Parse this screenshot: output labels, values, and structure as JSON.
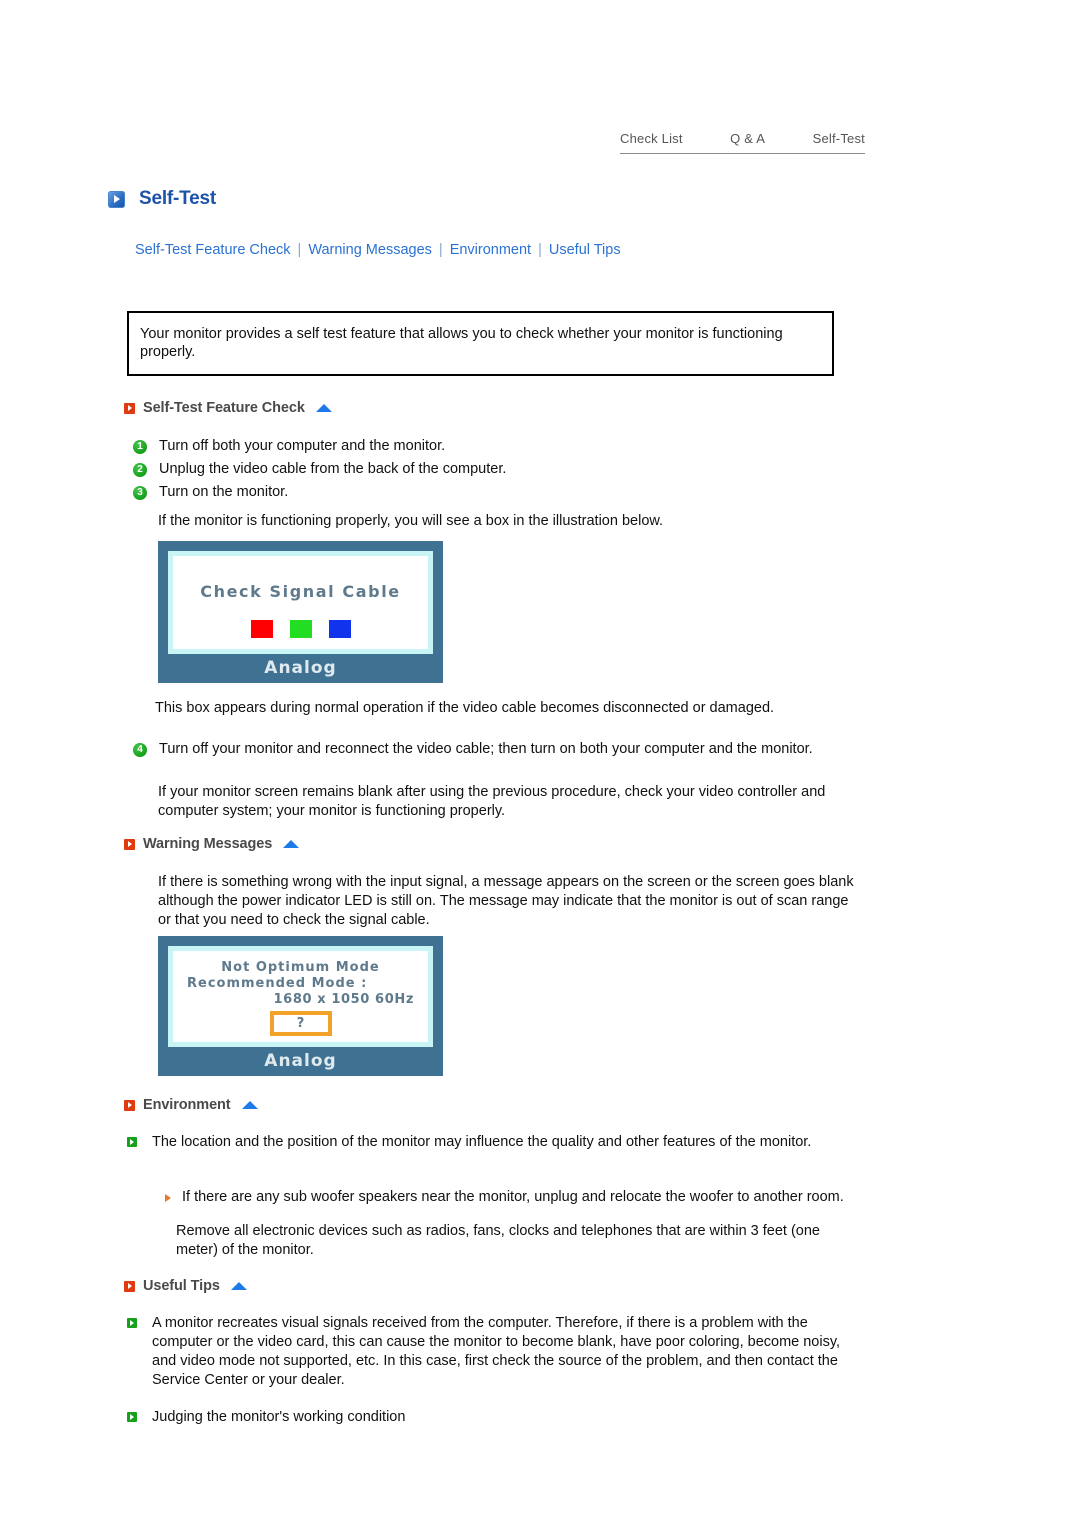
{
  "topnav": {
    "items": [
      {
        "label": "Check List"
      },
      {
        "label": "Q & A"
      },
      {
        "label": "Self-Test"
      }
    ]
  },
  "header": {
    "title": "Self-Test",
    "icon": "blue-play-square-icon"
  },
  "anchor_links": {
    "items": [
      {
        "label": "Self-Test Feature Check"
      },
      {
        "label": "Warning Messages"
      },
      {
        "label": "Environment"
      },
      {
        "label": "Useful Tips"
      }
    ],
    "separator": "|"
  },
  "intro": {
    "text": "Your monitor provides a self test feature that allows you to check whether your monitor is functioning properly."
  },
  "sections": {
    "feature_check": {
      "heading": "Self-Test Feature Check",
      "steps": [
        {
          "num": "1",
          "text": "Turn off both your computer and the monitor."
        },
        {
          "num": "2",
          "text": "Unplug the video cable from the back of the computer."
        },
        {
          "num": "3",
          "text": "Turn on the monitor."
        }
      ],
      "after_steps": "If the monitor is functioning properly, you will see a box in the illustration below.",
      "after_image": "This box appears during normal operation if the video cable becomes disconnected or damaged.",
      "step4": {
        "num": "4",
        "text": "Turn off your monitor and reconnect the video cable; then turn on both your computer and the monitor."
      },
      "step4_note": "If your monitor screen remains blank after using the previous procedure, check your video controller and computer system; your monitor is functioning properly."
    },
    "warning_messages": {
      "heading": "Warning Messages",
      "text": "If there is something wrong with the input signal, a message appears on the screen or the screen goes blank although the power indicator LED is still on. The message may indicate that the monitor is out of scan range or that you need to check the signal cable."
    },
    "environment": {
      "heading": "Environment",
      "bullet": "The location and the position of the monitor may influence the quality and other features of the monitor.",
      "sub_bullet_line1": "If there are any sub woofer speakers near the monitor, unplug and relocate the woofer to another room.",
      "sub_bullet_line2": "Remove all electronic devices such as radios, fans, clocks and telephones that are within 3 feet (one meter) of the monitor."
    },
    "useful_tips": {
      "heading": "Useful Tips",
      "bullet1": "A monitor recreates visual signals received from the computer. Therefore, if there is a problem with the computer or the video card, this can cause the monitor to become blank, have poor coloring, become noisy, and video mode not supported, etc. In this case, first check the source of the problem, and then contact the Service Center or your dealer.",
      "bullet2": "Judging the monitor's working condition"
    }
  },
  "osd_signal": {
    "title": "Check Signal Cable",
    "caption": "Analog",
    "colors": {
      "red": "#ff0000",
      "green": "#22dd22",
      "blue": "#1133ee"
    }
  },
  "osd_mode": {
    "line1": "Not Optimum Mode",
    "line2": "Recommended Mode :",
    "line3": "1680 x 1050   60Hz",
    "question": "?",
    "caption": "Analog",
    "accent": "#f2a229"
  }
}
